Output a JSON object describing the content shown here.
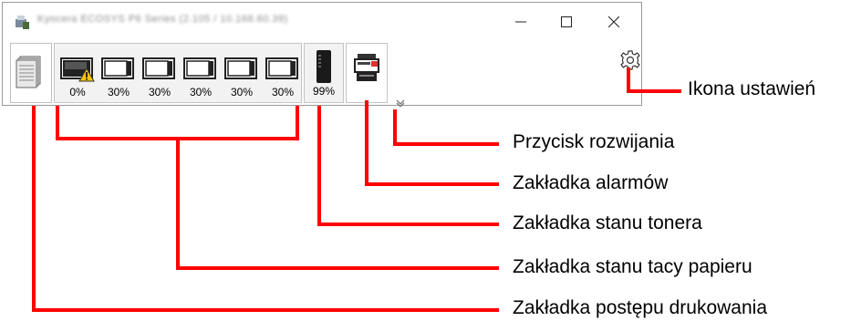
{
  "window": {
    "title": "Kyocera ECOSYS P6 Series (2.105 / 10.168.60.39)",
    "controls": {
      "minimize": "—",
      "maximize": "☐",
      "close": "✕"
    }
  },
  "toolbar": {
    "tabs": [
      {
        "name": "print-progress",
        "icon": "document-stack-icon"
      },
      {
        "name": "paper-trays",
        "icon": "paper-tray-icon"
      },
      {
        "name": "toner",
        "icon": "toner-cartridge-icon"
      },
      {
        "name": "alarm",
        "icon": "printer-alarm-icon"
      }
    ],
    "trays": [
      {
        "level": "0%",
        "warning": true
      },
      {
        "level": "30%",
        "warning": false
      },
      {
        "level": "30%",
        "warning": false
      },
      {
        "level": "30%",
        "warning": false
      },
      {
        "level": "30%",
        "warning": false
      },
      {
        "level": "30%",
        "warning": false
      }
    ],
    "toner_level": "99%",
    "expand_icon": "chevron-down-icon",
    "settings_icon": "gear-icon"
  },
  "callouts": {
    "settings": "Ikona ustawień",
    "expand": "Przycisk rozwijania",
    "alarm": "Zakładka alarmów",
    "toner": "Zakładka stanu tonera",
    "trays": "Zakładka stanu tacy papieru",
    "progress": "Zakładka postępu drukowania"
  },
  "colors": {
    "callout_line": "#ff0000",
    "warning": "#f5c400"
  }
}
